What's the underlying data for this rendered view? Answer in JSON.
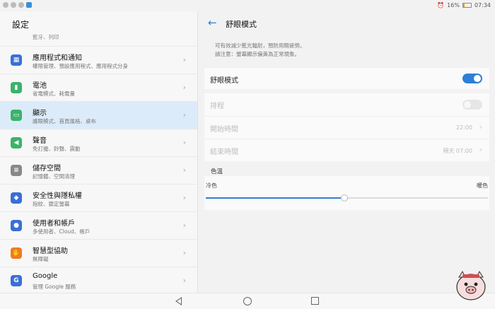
{
  "status": {
    "battery_text": "16%",
    "battery_level": 0.16,
    "time": "07:34"
  },
  "left": {
    "title": "設定",
    "partial_subtitle": "藍牙、列印",
    "items": [
      {
        "title": "應用程式和通知",
        "subtitle": "權限管理、預設應用程式、應用程式分身",
        "icon": "apps-icon",
        "color": "#3a6fd6",
        "selected": false
      },
      {
        "title": "電池",
        "subtitle": "省電模式、耗電量",
        "icon": "battery-icon",
        "color": "#3bb36b",
        "selected": false
      },
      {
        "title": "顯示",
        "subtitle": "護眼模式、首頁風格、桌布",
        "icon": "display-icon",
        "color": "#3bb36b",
        "selected": true
      },
      {
        "title": "聲音",
        "subtitle": "免打擾、鈴聲、震動",
        "icon": "sound-icon",
        "color": "#3bb36b",
        "selected": false
      },
      {
        "title": "儲存空間",
        "subtitle": "記憶體、空間清理",
        "icon": "storage-icon",
        "color": "#888888",
        "selected": false
      },
      {
        "title": "安全性與隱私權",
        "subtitle": "指紋、鎖定螢幕",
        "icon": "shield-icon",
        "color": "#3a6fd6",
        "selected": false
      },
      {
        "title": "使用者和帳戶",
        "subtitle": "多使用者、Cloud、帳戶",
        "icon": "user-icon",
        "color": "#3a6fd6",
        "selected": false
      },
      {
        "title": "智慧型協助",
        "subtitle": "無障礙",
        "icon": "hand-icon",
        "color": "#f07a20",
        "selected": false
      },
      {
        "title": "Google",
        "subtitle": "管理 Google 服務",
        "icon": "google-icon",
        "color": "#3a6fd6",
        "selected": false
      }
    ]
  },
  "right": {
    "title": "舒眼模式",
    "desc_line1": "可有效減少藍光輻射，預防用眼疲勞。",
    "desc_line2": "請注意：螢幕顯示偏黃為正常現象。",
    "eye_comfort_label": "舒眼模式",
    "eye_comfort_on": true,
    "schedule_label": "排程",
    "schedule_on": false,
    "start_label": "開始時間",
    "start_value": "22:00",
    "end_label": "結束時間",
    "end_value": "隔天 07:00",
    "temp_title": "色溫",
    "cool_label": "冷色",
    "warm_label": "暖色",
    "temp_level": 0.49
  },
  "icons": {
    "back": "back-arrow-icon",
    "nav_back": "nav-back-icon",
    "nav_home": "nav-home-icon",
    "nav_recent": "nav-recent-icon"
  }
}
